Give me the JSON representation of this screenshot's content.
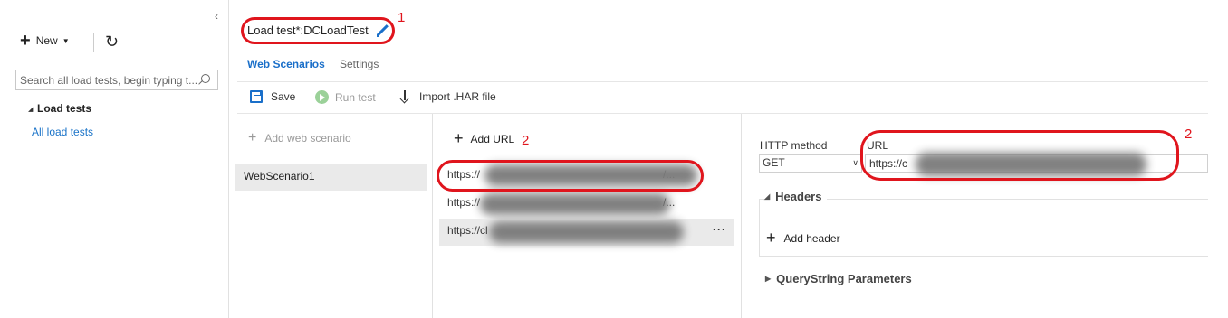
{
  "nav": {
    "collapse_glyph": "‹",
    "new_label": "New",
    "search_placeholder": "Search all load tests, begin typing t...",
    "tree_heading": "Load tests",
    "tree_link": "All load tests"
  },
  "header": {
    "title": "Load test*:DCLoadTest",
    "annotation_1": "1",
    "annotation_2": "2"
  },
  "tabs": [
    {
      "label": "Web Scenarios",
      "active": true
    },
    {
      "label": "Settings",
      "active": false
    }
  ],
  "toolbar": {
    "save_label": "Save",
    "run_label": "Run test",
    "import_label": "Import .HAR file"
  },
  "scenarios": {
    "add_label": "Add web scenario",
    "items": [
      "WebScenario1"
    ]
  },
  "urls": {
    "add_label": "Add URL",
    "items": [
      {
        "prefix": "https://",
        "suffix": "/..."
      },
      {
        "prefix": "https://",
        "suffix": "/..."
      },
      {
        "prefix": "https://cl",
        "suffix": ""
      }
    ],
    "more_glyph": "···"
  },
  "details": {
    "method_label": "HTTP method",
    "method_value": "GET",
    "url_label": "URL",
    "url_value": "https://c",
    "headers_title": "Headers",
    "add_header_label": "Add header",
    "query_title": "QueryString Parameters"
  },
  "colors": {
    "accent": "#1a6fc9",
    "annotation_red": "#e0151d",
    "selected_bg": "#eaeaea"
  }
}
